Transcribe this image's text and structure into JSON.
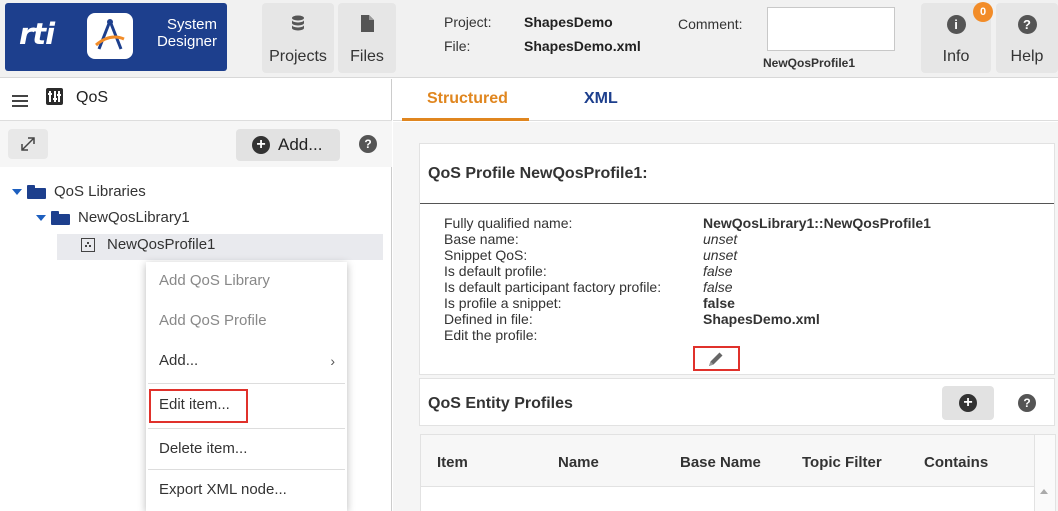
{
  "topbar": {
    "brand_logo": "rti",
    "brand_line1": "System",
    "brand_line2": "Designer",
    "projects_label": "Projects",
    "files_label": "Files",
    "project_label": "Project:",
    "project_value": "ShapesDemo",
    "file_label": "File:",
    "file_value": "ShapesDemo.xml",
    "comment_label": "Comment:",
    "comment_value": "NewQosProfile1",
    "info_label": "Info",
    "info_badge": "0",
    "help_label": "Help",
    "accent_color": "#f28c28",
    "brand_color": "#1d3f8d"
  },
  "left_panel": {
    "title": "QoS",
    "add_label": "Add...",
    "tree": [
      {
        "label": "QoS Libraries",
        "level": 0,
        "expanded": true
      },
      {
        "label": "NewQosLibrary1",
        "level": 1,
        "expanded": true
      },
      {
        "label": "NewQosProfile1",
        "level": 2,
        "selected": true
      }
    ]
  },
  "context_menu": {
    "items": [
      {
        "label": "Add QoS Library",
        "enabled": false
      },
      {
        "label": "Add QoS Profile",
        "enabled": false
      },
      {
        "label": "Add...",
        "enabled": true,
        "submenu": true
      },
      {
        "label": "Edit item...",
        "enabled": true,
        "highlighted": true
      },
      {
        "label": "Delete item...",
        "enabled": true
      },
      {
        "label": "Export XML node...",
        "enabled": true
      }
    ]
  },
  "tabs": [
    {
      "label": "Structured",
      "active": true
    },
    {
      "label": "XML",
      "active": false
    }
  ],
  "profile": {
    "title": "QoS Profile NewQosProfile1:",
    "properties": [
      {
        "label": "Fully qualified name:",
        "value": "NewQosLibrary1::NewQosProfile1",
        "style": "bold"
      },
      {
        "label": "Base name:",
        "value": "unset",
        "style": "italic"
      },
      {
        "label": "Snippet QoS:",
        "value": "unset",
        "style": "italic"
      },
      {
        "label": "Is default profile:",
        "value": "false",
        "style": "italic"
      },
      {
        "label": "Is default participant factory profile:",
        "value": "false",
        "style": "italic"
      },
      {
        "label": "Is profile a snippet:",
        "value": "false",
        "style": "bold"
      },
      {
        "label": "Defined in file:",
        "value": "ShapesDemo.xml",
        "style": "bold"
      },
      {
        "label": "Edit the profile:",
        "value": "",
        "style": "icon"
      }
    ]
  },
  "entity_profiles": {
    "title": "QoS Entity Profiles",
    "columns": [
      "Item",
      "Name",
      "Base Name",
      "Topic Filter",
      "Contains"
    ]
  },
  "icons": {
    "projects": "database-icon",
    "files": "file-icon",
    "info": "info-icon",
    "help": "help-icon",
    "menu": "hamburger-icon",
    "qos": "qos-sliders-icon",
    "expand": "expand-icon",
    "add": "plus-circle-icon",
    "edit": "pencil-icon"
  }
}
